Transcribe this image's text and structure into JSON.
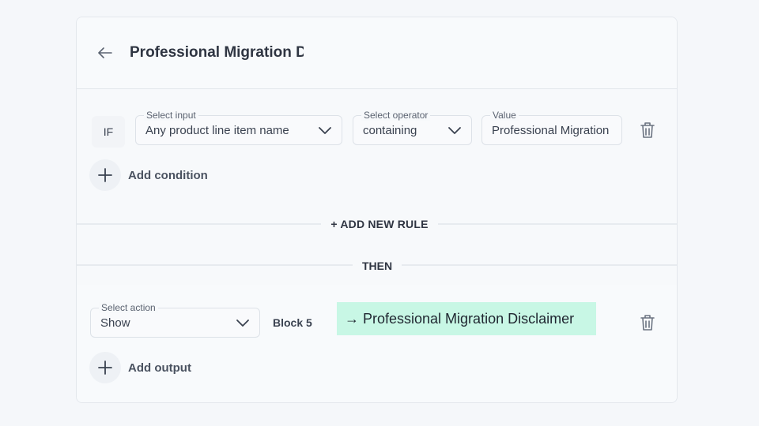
{
  "header": {
    "title": "Professional Migration Di",
    "back_icon": "arrow-left-icon"
  },
  "condition": {
    "if_label": "IF",
    "input": {
      "label": "Select input",
      "value": "Any product line item name"
    },
    "operator": {
      "label": "Select operator",
      "value": "containing"
    },
    "value": {
      "label": "Value",
      "value": "Professional Migration"
    },
    "add_condition_label": "Add condition"
  },
  "rules": {
    "add_new_rule_label": "+ ADD NEW RULE",
    "then_label": "THEN"
  },
  "action": {
    "select": {
      "label": "Select action",
      "value": "Show"
    },
    "block_label": "Block 5",
    "target_label": "→ Professional Migration Disclaimer",
    "add_output_label": "Add output"
  },
  "colors": {
    "highlight": "#c8f7e5",
    "text": "#2f3542",
    "border": "#dde2e8"
  }
}
